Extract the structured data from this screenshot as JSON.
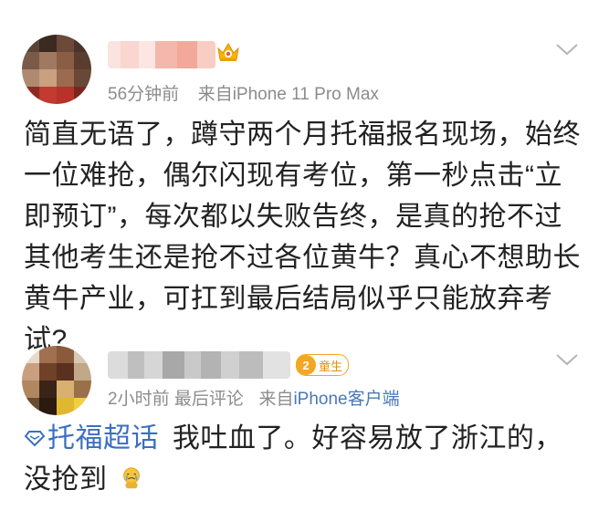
{
  "post": {
    "time": "56分钟前",
    "source": "来自iPhone 11 Pro Max",
    "content_lines": [
      "简直无语了，蹲守两个月托福报名现场，始终",
      "一位难抢，偶尔闪现有考位，第一秒点击“立",
      "即预订”，每次都以失败告终，是真的抢不过",
      "其他考生还是抢不过各位黄牛？真心不想助长",
      "黄牛产业，可扛到最后结局似乎只能放弃考",
      "试?"
    ]
  },
  "comment": {
    "badge_level": "2",
    "badge_label": "童生",
    "time": "2小时前",
    "last_comment_label": "最后评论",
    "source_prefix": "来自",
    "source_link": "iPhone客户端",
    "topic_link": "托福超话",
    "content_line1": "我吐血了。好容易放了浙江的，",
    "content_line2": "没抢到"
  },
  "icons": {
    "crown": "vip-crown-icon",
    "chevron": "chevron-down-icon",
    "supertopic": "supertopic-diamond-icon",
    "emoji": "crying-emoji-icon"
  }
}
